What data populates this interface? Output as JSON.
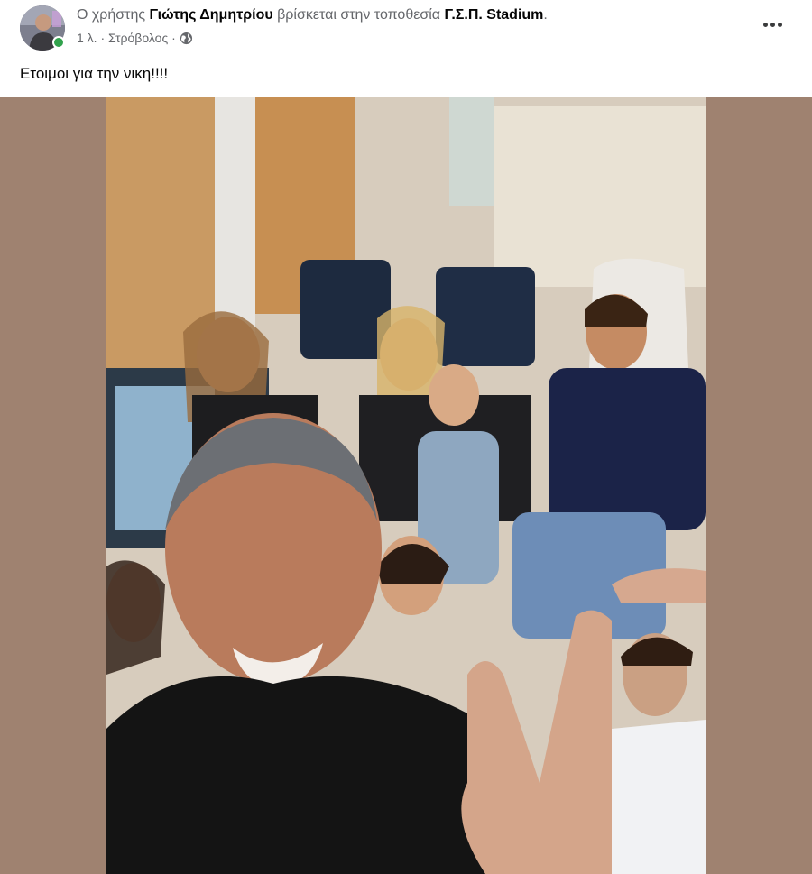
{
  "post": {
    "author_prefix": "Ο χρήστης ",
    "author_name": "Γιώτης Δημητρίου",
    "location_prefix": " βρίσκεται στην τοποθεσία ",
    "location_name": "Γ.Σ.Π. Stadium",
    "location_suffix": ".",
    "time": "1 λ.",
    "place": "Στρόβολος",
    "separator": "·",
    "audience_icon": "globe-icon",
    "caption": "Ετοιμοι για την νικη!!!!",
    "more_icon": "more-options-icon",
    "online_status_color": "#31a24c"
  },
  "media": {
    "letterbox_color": "#9f8270",
    "description_kind": "photo"
  }
}
